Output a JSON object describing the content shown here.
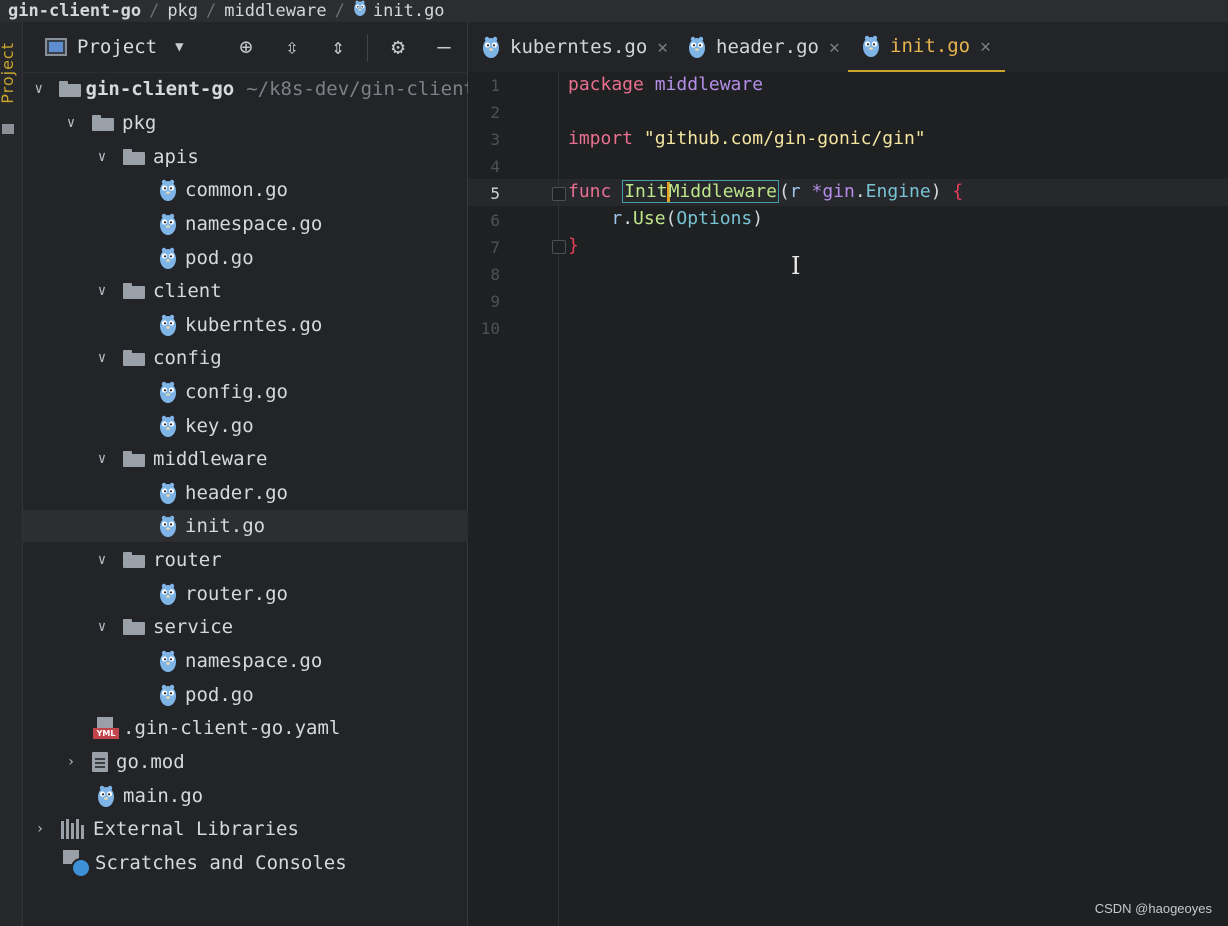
{
  "breadcrumb": {
    "items": [
      "gin-client-go",
      "pkg",
      "middleware",
      "init.go"
    ]
  },
  "sidebar": {
    "vertical_tab": "Project"
  },
  "project_panel": {
    "view_label": "Project",
    "tools": [
      "locate-icon",
      "expand-all-icon",
      "collapse-all-icon",
      "gear-icon",
      "minimize-icon"
    ],
    "root": {
      "name": "gin-client-go",
      "path": "~/k8s-dev/gin-client"
    },
    "tree": [
      {
        "label": "pkg"
      },
      {
        "label": "apis"
      },
      {
        "label": "common.go"
      },
      {
        "label": "namespace.go"
      },
      {
        "label": "pod.go"
      },
      {
        "label": "client"
      },
      {
        "label": "kuberntes.go"
      },
      {
        "label": "config"
      },
      {
        "label": "config.go"
      },
      {
        "label": "key.go"
      },
      {
        "label": "middleware"
      },
      {
        "label": "header.go"
      },
      {
        "label": "init.go"
      },
      {
        "label": "router"
      },
      {
        "label": "router.go"
      },
      {
        "label": "service"
      },
      {
        "label": "namespace.go"
      },
      {
        "label": "pod.go"
      },
      {
        "label": ".gin-client-go.yaml"
      },
      {
        "label": "go.mod"
      },
      {
        "label": "main.go"
      },
      {
        "label": "External Libraries"
      },
      {
        "label": "Scratches and Consoles"
      }
    ],
    "yml_tag": "YML"
  },
  "editor": {
    "tabs": [
      {
        "label": "kuberntes.go"
      },
      {
        "label": "header.go"
      },
      {
        "label": "init.go"
      }
    ],
    "line_numbers": [
      "1",
      "2",
      "3",
      "4",
      "5",
      "6",
      "7",
      "8",
      "9",
      "10"
    ],
    "code": {
      "l1_kw": "package",
      "l1_name": "middleware",
      "l3_kw": "import",
      "l3_str": "\"github.com/gin-gonic/gin\"",
      "l5_kw": "func",
      "l5_fn_a": "Init",
      "l5_fn_b": "Middleware",
      "l5_open": "(",
      "l5_param": "r",
      "l5_star": "*",
      "l5_pkg": "gin",
      "l5_dot": ".",
      "l5_type": "Engine",
      "l5_close": ")",
      "l5_brace": "{",
      "l6_recv": "r",
      "l6_dot": ".",
      "l6_method": "Use",
      "l6_open": "(",
      "l6_arg": "Options",
      "l6_close": ")",
      "l7_brace": "}"
    },
    "cursor_glyph": "I"
  },
  "watermark": "CSDN @haogeoyes"
}
